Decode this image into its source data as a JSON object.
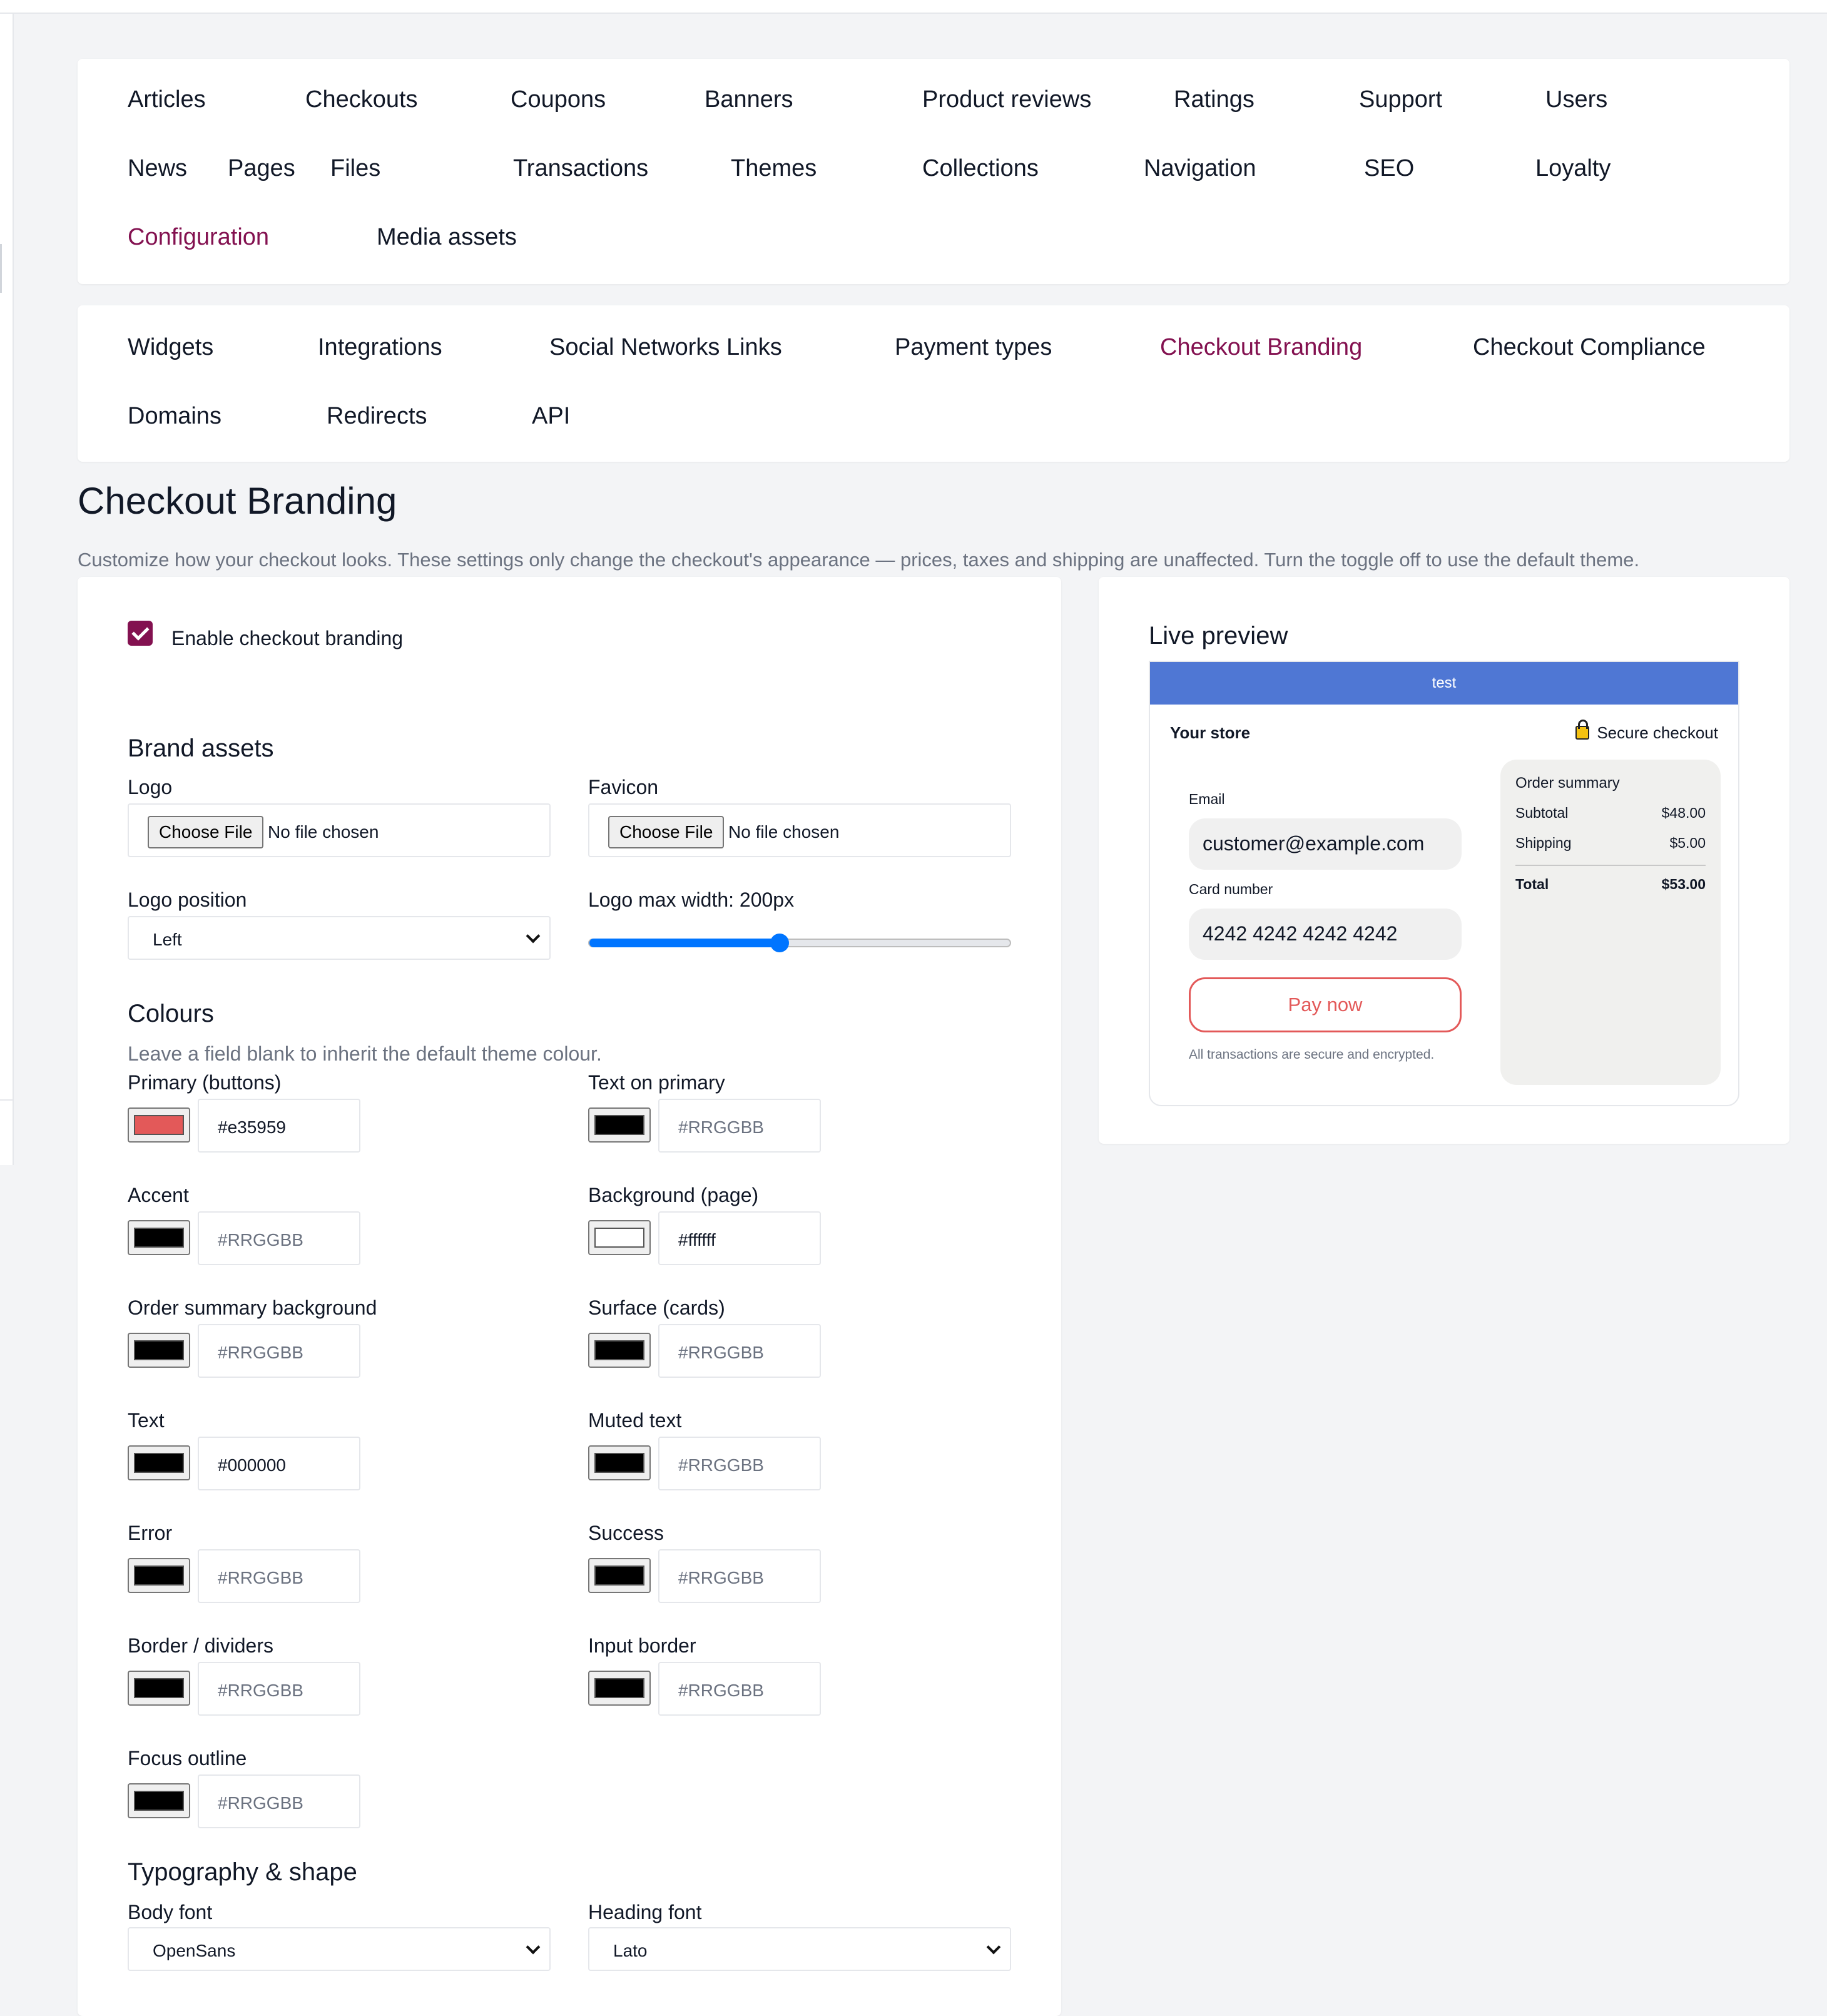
{
  "main_nav": [
    "Articles",
    "Checkouts",
    "Coupons",
    "Banners",
    "Product reviews",
    "Ratings",
    "Support",
    "Users",
    "News",
    "Pages",
    "Files",
    "Transactions",
    "Themes",
    "Collections",
    "Navigation",
    "SEO",
    "Loyalty",
    "Configuration",
    "Media assets"
  ],
  "main_nav_active": "Configuration",
  "sub_nav": [
    "Widgets",
    "Integrations",
    "Social Networks Links",
    "Payment types",
    "Checkout Branding",
    "Checkout Compliance",
    "Domains",
    "Redirects",
    "API"
  ],
  "sub_nav_active": "Checkout Branding",
  "page": {
    "title": "Checkout Branding",
    "description": "Customize how your checkout looks. These settings only change the checkout's appearance — prices, taxes and shipping are unaffected. Turn the toggle off to use the default theme."
  },
  "form": {
    "enable_label": "Enable checkout branding",
    "enable_checked": true,
    "brand_assets_heading": "Brand assets",
    "logo_label": "Logo",
    "favicon_label": "Favicon",
    "choose_file": "Choose File",
    "no_file": "No file chosen",
    "logo_position_label": "Logo position",
    "logo_position_value": "Left",
    "logo_max_width_label": "Logo max width: 200px",
    "logo_max_width_fraction": 0.45,
    "colours_heading": "Colours",
    "colours_help": "Leave a field blank to inherit the default theme colour.",
    "colours": [
      {
        "label": "Primary (buttons)",
        "value": "#e35959",
        "swatch": "#e35959"
      },
      {
        "label": "Text on primary",
        "value": "",
        "swatch": "#000000"
      },
      {
        "label": "Accent",
        "value": "",
        "swatch": "#000000"
      },
      {
        "label": "Background (page)",
        "value": "#ffffff",
        "swatch": "#ffffff"
      },
      {
        "label": "Order summary background",
        "value": "",
        "swatch": "#000000"
      },
      {
        "label": "Surface (cards)",
        "value": "",
        "swatch": "#000000"
      },
      {
        "label": "Text",
        "value": "#000000",
        "swatch": "#000000"
      },
      {
        "label": "Muted text",
        "value": "",
        "swatch": "#000000"
      },
      {
        "label": "Error",
        "value": "",
        "swatch": "#000000"
      },
      {
        "label": "Success",
        "value": "",
        "swatch": "#000000"
      },
      {
        "label": "Border / dividers",
        "value": "",
        "swatch": "#000000"
      },
      {
        "label": "Input border",
        "value": "",
        "swatch": "#000000"
      },
      {
        "label": "Focus outline",
        "value": "",
        "swatch": "#000000"
      }
    ],
    "hex_placeholder": "#RRGGBB",
    "typography_heading": "Typography & shape",
    "body_font_label": "Body font",
    "body_font_value": "OpenSans",
    "heading_font_label": "Heading font",
    "heading_font_value": "Lato"
  },
  "preview": {
    "title": "Live preview",
    "banner": "test",
    "store": "Your store",
    "secure": "Secure checkout",
    "email_label": "Email",
    "email_value": "customer@example.com",
    "card_label": "Card number",
    "card_value": "4242 4242 4242 4242",
    "pay_label": "Pay now",
    "note": "All transactions are secure and encrypted.",
    "summary_title": "Order summary",
    "subtotal_label": "Subtotal",
    "subtotal_value": "$48.00",
    "shipping_label": "Shipping",
    "shipping_value": "$5.00",
    "total_label": "Total",
    "total_value": "$53.00",
    "banner_color": "#4f77d4",
    "primary_color": "#e35959"
  },
  "accent_color": "#831150"
}
